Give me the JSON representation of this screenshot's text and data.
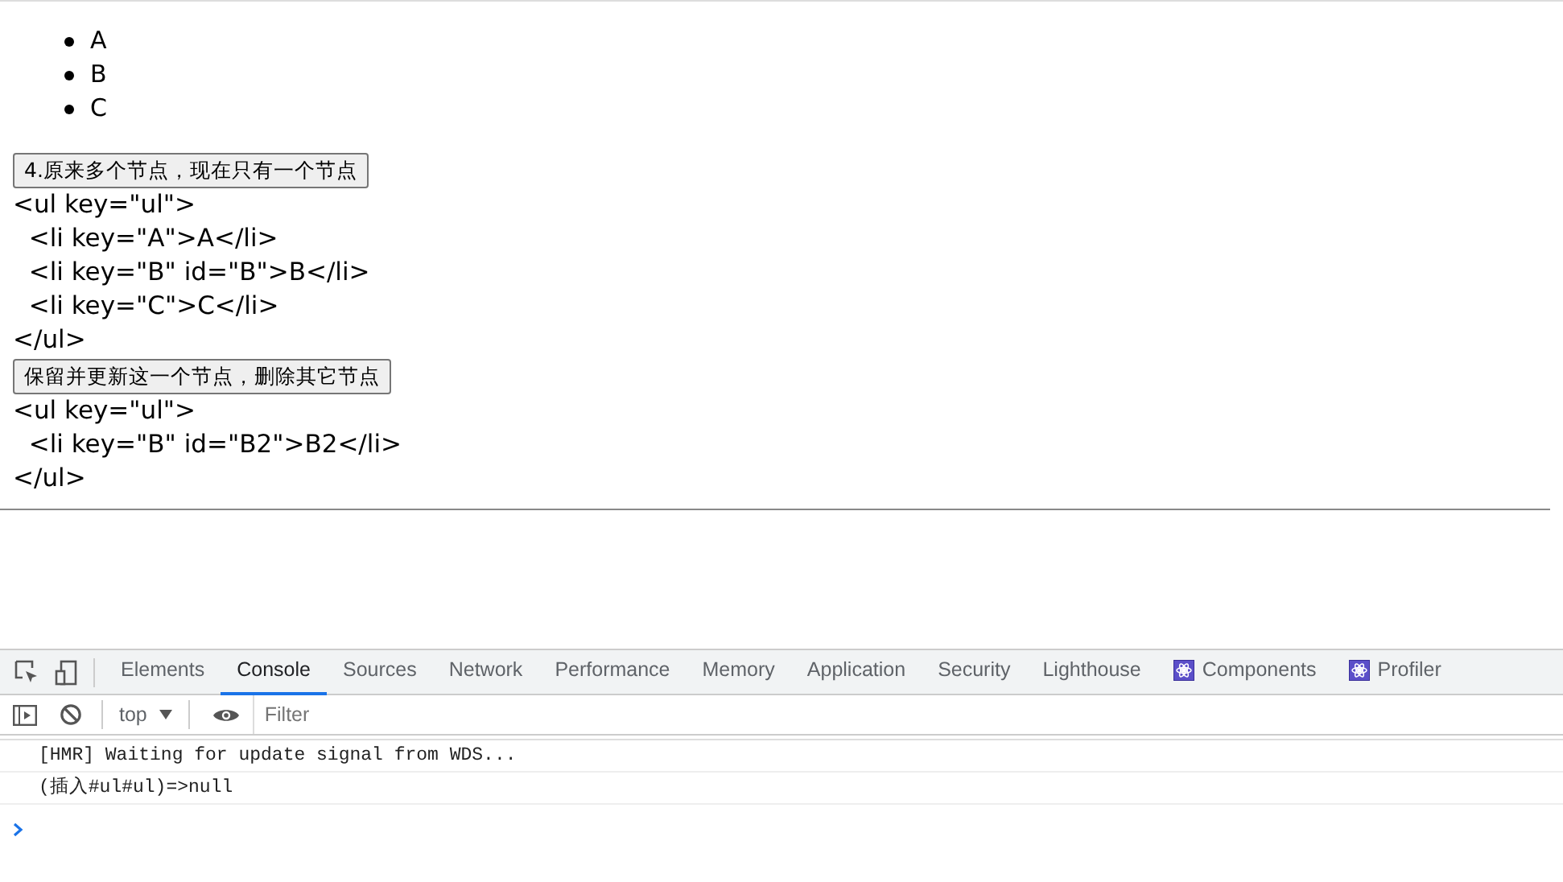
{
  "page": {
    "list_items": [
      "A",
      "B",
      "C"
    ],
    "sections": [
      {
        "button": "4.原来多个节点，现在只有一个节点",
        "code_lines": [
          "<ul key=\"ul\">",
          "  <li key=\"A\">A</li>",
          "  <li key=\"B\" id=\"B\">B</li>",
          "  <li key=\"C\">C</li>",
          "</ul>"
        ]
      },
      {
        "button": "保留并更新这一个节点，删除其它节点",
        "code_lines": [
          "<ul key=\"ul\">",
          "  <li key=\"B\" id=\"B2\">B2</li>",
          "</ul>"
        ]
      }
    ]
  },
  "devtools": {
    "tabs": [
      {
        "label": "Elements",
        "kind": "plain",
        "selected": false
      },
      {
        "label": "Console",
        "kind": "plain",
        "selected": true
      },
      {
        "label": "Sources",
        "kind": "plain",
        "selected": false
      },
      {
        "label": "Network",
        "kind": "plain",
        "selected": false
      },
      {
        "label": "Performance",
        "kind": "plain",
        "selected": false
      },
      {
        "label": "Memory",
        "kind": "plain",
        "selected": false
      },
      {
        "label": "Application",
        "kind": "plain",
        "selected": false
      },
      {
        "label": "Security",
        "kind": "plain",
        "selected": false
      },
      {
        "label": "Lighthouse",
        "kind": "plain",
        "selected": false
      },
      {
        "label": "Components",
        "kind": "react",
        "selected": false
      },
      {
        "label": "Profiler",
        "kind": "react",
        "selected": false
      }
    ],
    "context": "top",
    "filter": {
      "placeholder": "Filter"
    },
    "messages": [
      "[HMR] Waiting for update signal from WDS...",
      "(插入#ul#ul)=>null"
    ]
  }
}
